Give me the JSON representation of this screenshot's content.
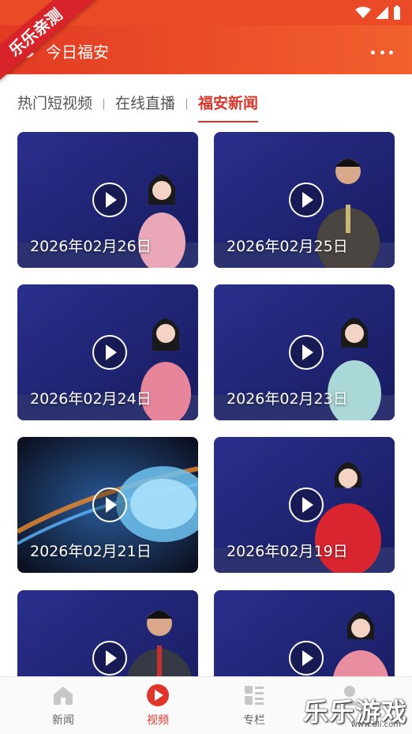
{
  "status_bar": {
    "color": "#ea4a26"
  },
  "ribbon": {
    "text": "乐乐亲测"
  },
  "app_bar": {
    "title": "今日福安",
    "more_icon": "more-horizontal-icon"
  },
  "tabs": [
    {
      "label": "热门短视频",
      "active": false
    },
    {
      "label": "在线直播",
      "active": false
    },
    {
      "label": "福安新闻",
      "active": true
    }
  ],
  "videos": [
    {
      "date": "2026年02月26日"
    },
    {
      "date": "2026年02月25日"
    },
    {
      "date": "2026年02月24日"
    },
    {
      "date": "2026年02月23日"
    },
    {
      "date": "2026年02月21日"
    },
    {
      "date": "2026年02月19日"
    },
    {
      "date": ""
    },
    {
      "date": ""
    }
  ],
  "bottom_nav": [
    {
      "label": "新闻",
      "icon": "home-icon",
      "active": false
    },
    {
      "label": "视频",
      "icon": "play-circle-icon",
      "active": true
    },
    {
      "label": "专栏",
      "icon": "column-grid-icon",
      "active": false
    },
    {
      "label": "",
      "icon": "person-icon",
      "active": false
    }
  ],
  "watermark": {
    "text": "乐乐游戏",
    "url": "www.6ll.com"
  },
  "colors": {
    "accent": "#e0352b",
    "header_start": "#e23b23",
    "header_end": "#f2602e",
    "thumb_bg": "#23287a"
  }
}
